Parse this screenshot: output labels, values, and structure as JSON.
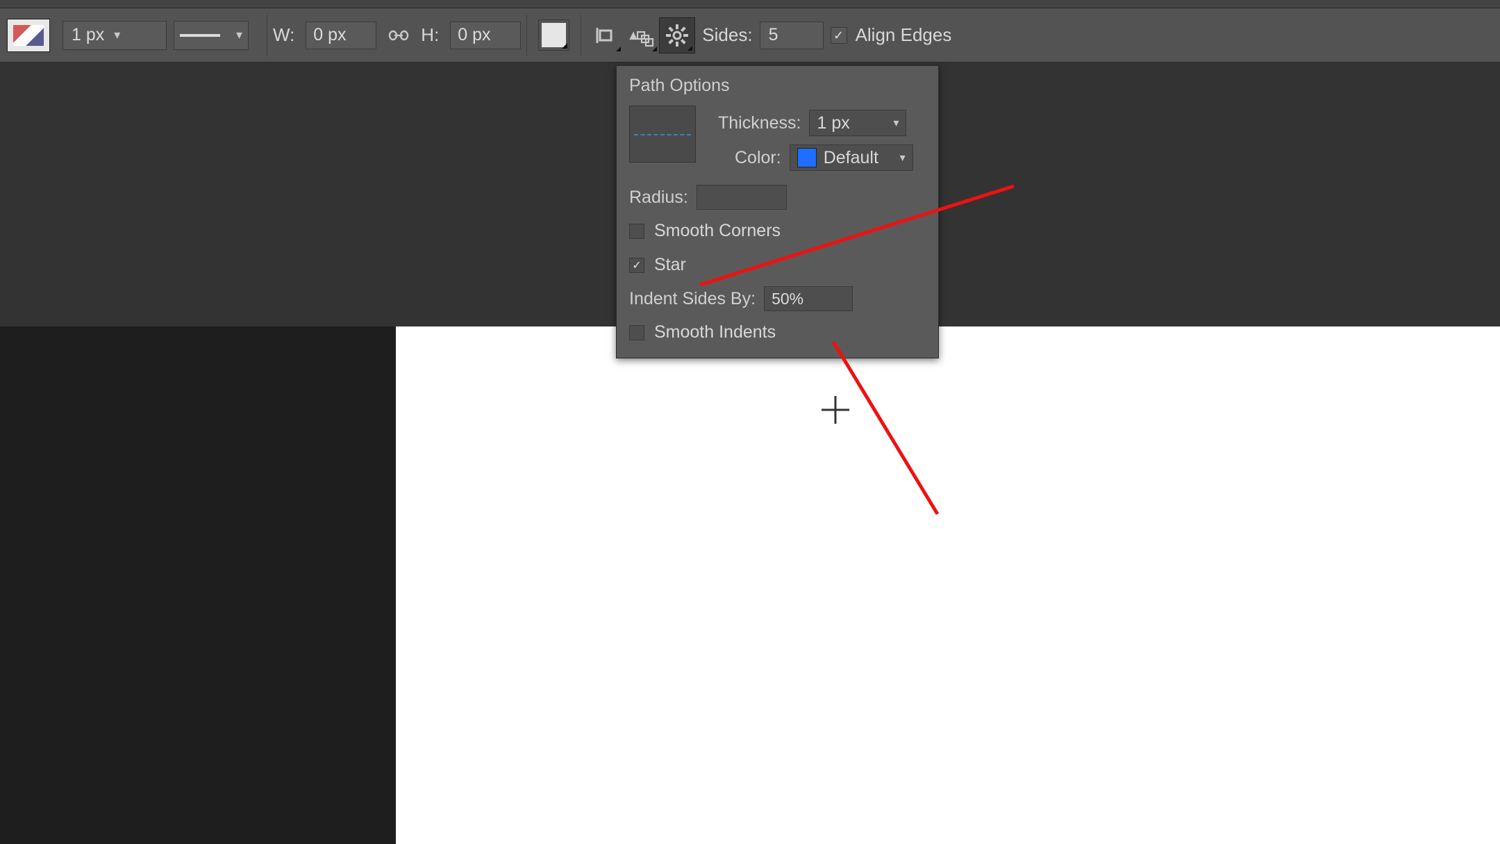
{
  "optionsBar": {
    "strokeWidth": "1 px",
    "W_label": "W:",
    "W_value": "0 px",
    "H_label": "H:",
    "H_value": "0 px",
    "sides_label": "Sides:",
    "sides_value": "5",
    "align_edges_label": "Align Edges",
    "align_edges_checked": "✓"
  },
  "panel": {
    "title": "Path Options",
    "thickness_label": "Thickness:",
    "thickness_value": "1 px",
    "color_label": "Color:",
    "color_value": "Default",
    "radius_label": "Radius:",
    "radius_value": "",
    "smooth_corners_label": "Smooth Corners",
    "star_label": "Star",
    "star_checked": "✓",
    "indent_label": "Indent Sides By:",
    "indent_value": "50%",
    "smooth_indents_label": "Smooth Indents"
  }
}
